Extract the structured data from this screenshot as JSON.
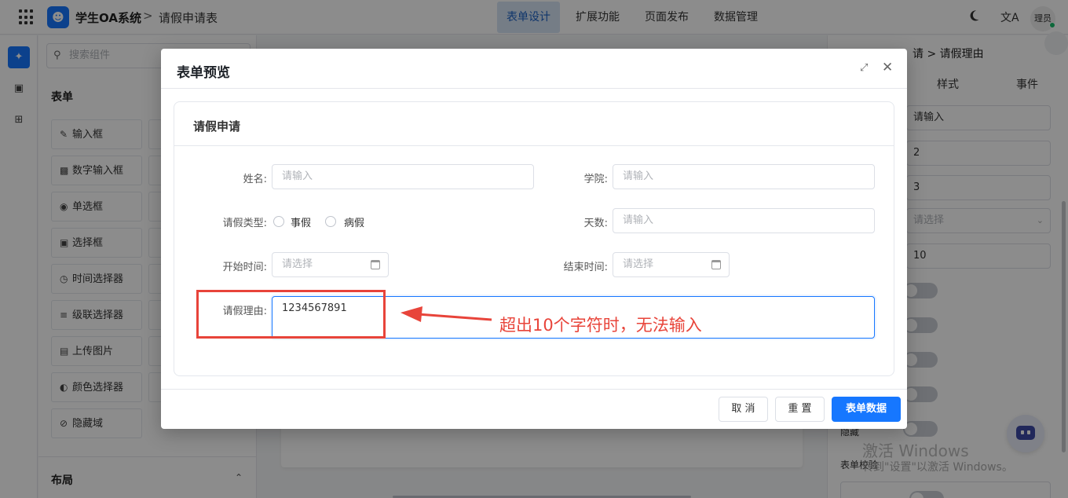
{
  "header": {
    "app_title": "学生OA系统",
    "separator": ">",
    "page_title": "请假申请表",
    "tabs": [
      {
        "label": "表单设计"
      },
      {
        "label": "扩展功能"
      },
      {
        "label": "页面发布"
      },
      {
        "label": "数据管理"
      }
    ],
    "active_tab": "表单设计",
    "avatar_text": "理员",
    "translate_glyph": "文A"
  },
  "components": {
    "search_placeholder": "搜索组件",
    "form_heading": "表单",
    "items": [
      {
        "label": "输入框",
        "icon": "edit-icon"
      },
      {
        "label": "数字输入框",
        "icon": "number-icon"
      },
      {
        "label": "单选框",
        "icon": "radio-icon"
      },
      {
        "label": "选择框",
        "icon": "select-icon"
      },
      {
        "label": "时间选择器",
        "icon": "clock-icon"
      },
      {
        "label": "级联选择器",
        "icon": "cascader-icon"
      },
      {
        "label": "上传图片",
        "icon": "image-icon"
      },
      {
        "label": "颜色选择器",
        "icon": "palette-icon"
      },
      {
        "label": "隐藏域",
        "icon": "eye-off-icon"
      }
    ],
    "layout_heading": "布局"
  },
  "properties": {
    "breadcrumb": "请 > 请假理由",
    "tabs": [
      {
        "label": "样式"
      },
      {
        "label": "事件"
      }
    ],
    "fields": [
      {
        "value": "请输入",
        "placeholder": false
      },
      {
        "value": "2",
        "placeholder": false
      },
      {
        "value": "3",
        "placeholder": false
      },
      {
        "value": "请选择",
        "placeholder": true
      },
      {
        "value": "10",
        "placeholder": false
      }
    ],
    "hidden_label": "隐藏",
    "validation_label": "表单校验"
  },
  "watermark": {
    "line1": "激活 Windows",
    "line2": "转到\"设置\"以激活 Windows。"
  },
  "dialog": {
    "title": "表单预览",
    "card_title": "请假申请",
    "fields": {
      "name": {
        "label": "姓名:",
        "placeholder": "请输入"
      },
      "college": {
        "label": "学院:",
        "placeholder": "请输入"
      },
      "leave_type": {
        "label": "请假类型:",
        "options": [
          "事假",
          "病假"
        ]
      },
      "days": {
        "label": "天数:",
        "placeholder": "请输入"
      },
      "start_time": {
        "label": "开始时间:",
        "placeholder": "请选择"
      },
      "end_time": {
        "label": "结束时间:",
        "placeholder": "请选择"
      },
      "reason": {
        "label": "请假理由:",
        "value": "1234567891"
      }
    },
    "annotation": "超出10个字符时，无法输入",
    "buttons": {
      "cancel": "取 消",
      "reset": "重 置",
      "submit": "表单数据"
    }
  },
  "colors": {
    "primary": "#1677ff",
    "annotation_red": "#e8443a",
    "active_tab_bg": "#d6e4f5"
  }
}
